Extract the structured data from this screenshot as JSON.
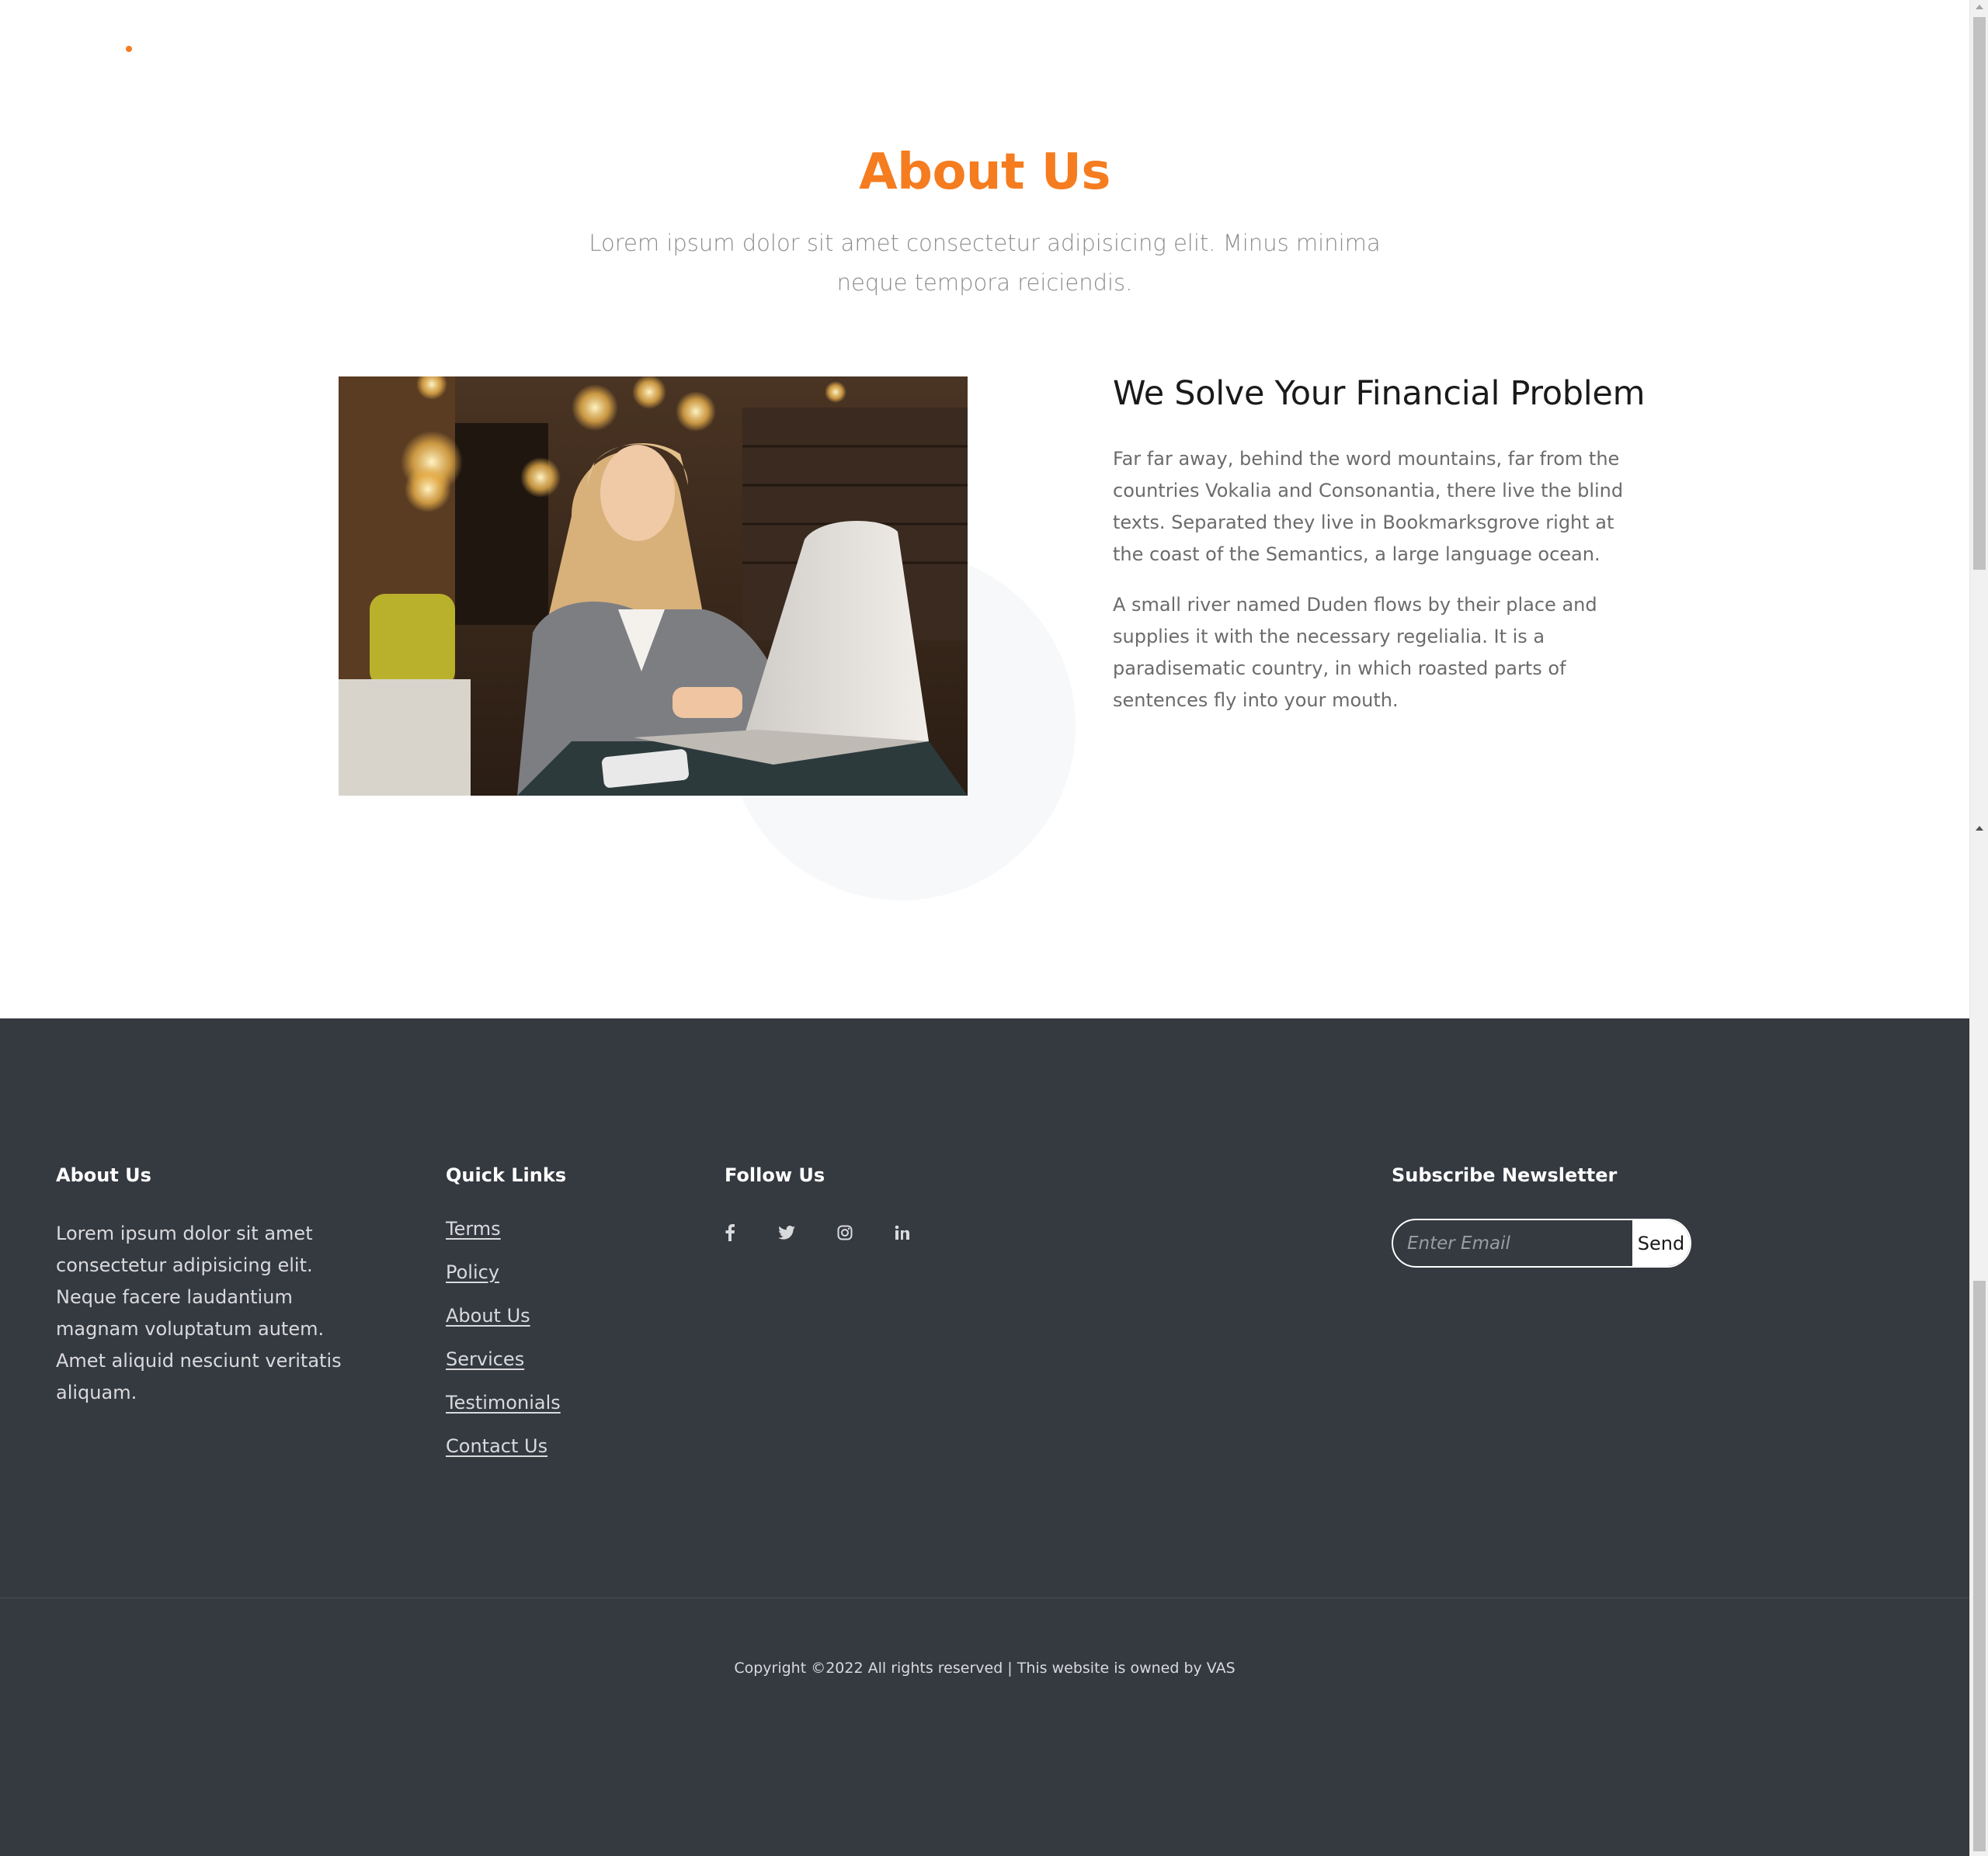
{
  "about": {
    "title": "About Us",
    "subtitle": "Lorem ipsum dolor sit amet consectetur adipisicing elit. Minus minima neque tempora reiciendis.",
    "image_alt": "woman working on laptop in cafe"
  },
  "feature": {
    "title": "We Solve Your Financial Problem",
    "paragraph1": "Far far away, behind the word mountains, far from the countries Vokalia and Consonantia, there live the blind texts. Separated they live in Bookmarksgrove right at the coast of the Semantics, a large language ocean.",
    "paragraph2": "A small river named Duden flows by their place and supplies it with the necessary regelialia. It is a paradisematic country, in which roasted parts of sentences fly into your mouth."
  },
  "footer": {
    "about_heading": "About Us",
    "about_text": "Lorem ipsum dolor sit amet consectetur adipisicing elit. Neque facere laudantium magnam voluptatum autem. Amet aliquid nesciunt veritatis aliquam.",
    "links_heading": "Quick Links",
    "links": [
      "Terms",
      "Policy",
      "About Us",
      "Services",
      "Testimonials",
      "Contact Us"
    ],
    "follow_heading": "Follow Us",
    "social_icons": [
      "facebook-icon",
      "twitter-icon",
      "instagram-icon",
      "linkedin-icon"
    ],
    "newsletter_heading": "Subscribe Newsletter",
    "email_placeholder": "Enter Email",
    "send_label": "Send",
    "copyright": "Copyright ©2022 All rights reserved | This website is owned by VAS"
  },
  "colors": {
    "accent": "#f57c1f",
    "footer_bg": "#353940",
    "text_muted": "#8c8c8c"
  }
}
